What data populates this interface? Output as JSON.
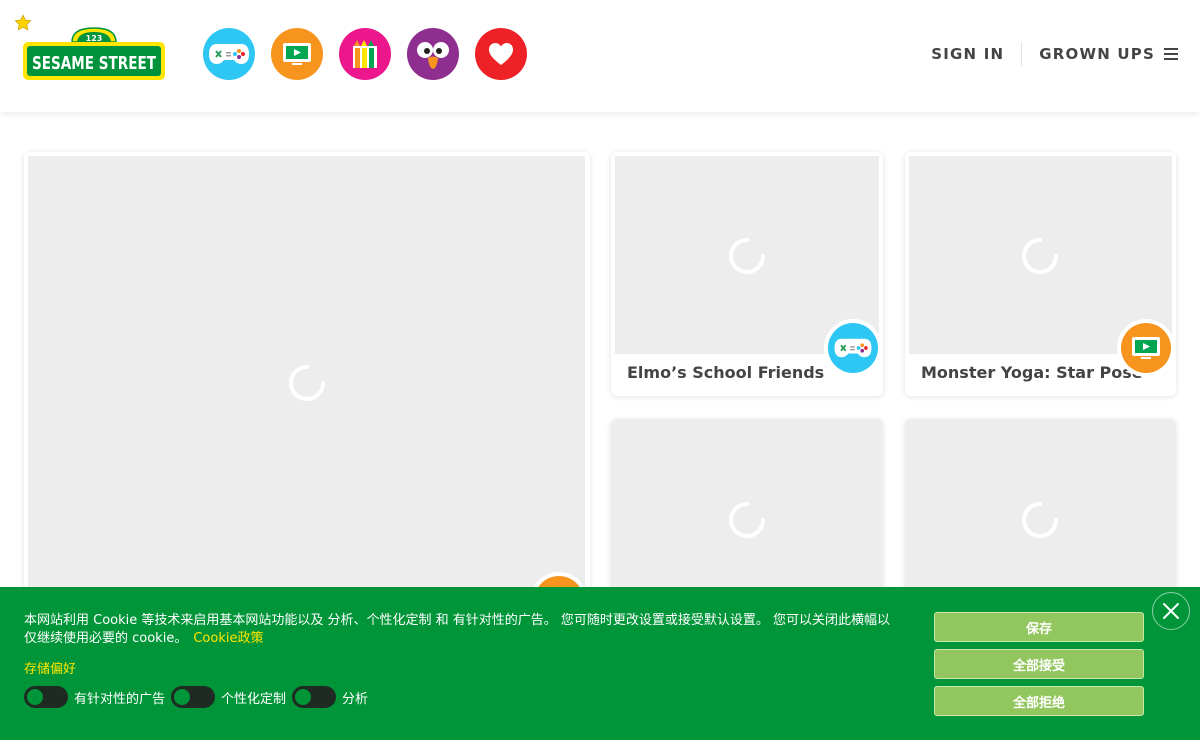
{
  "header": {
    "logo_text": "SESAME STREET",
    "logo_number": "123",
    "nav": [
      {
        "name": "games",
        "icon": "game-controller-icon",
        "color": "#2ec6f2"
      },
      {
        "name": "videos",
        "icon": "video-screen-icon",
        "color": "#f7941d"
      },
      {
        "name": "art",
        "icon": "crayons-icon",
        "color": "#ec178c"
      },
      {
        "name": "characters",
        "icon": "bird-face-icon",
        "color": "#8e2e8f"
      },
      {
        "name": "favorites",
        "icon": "heart-icon",
        "color": "#ee2126"
      }
    ],
    "sign_in": "SIGN IN",
    "grown_ups": "GROWN UPS"
  },
  "cards": [
    {
      "id": "featured",
      "title": "",
      "badge_icon": "video-screen-icon",
      "badge_color": "#f7941d"
    },
    {
      "id": "elmos-school-friends",
      "title": "Elmo’s School Friends",
      "badge_icon": "game-controller-icon",
      "badge_color": "#2ec6f2"
    },
    {
      "id": "monster-yoga",
      "title": "Monster Yoga: Star Pose",
      "badge_icon": "video-screen-icon",
      "badge_color": "#f7941d"
    },
    {
      "id": "card-4",
      "title": ""
    },
    {
      "id": "card-5",
      "title": ""
    }
  ],
  "cookie": {
    "text": "本网站利用 Cookie 等技术来启用基本网站功能以及 分析、个性化定制 和 有针对性的广告。 您可随时更改设置或接受默认设置。 您可以关闭此横幅以仅继续使用必要的 cookie。",
    "policy_link": "Cookie政策",
    "prefs_label": "存储偏好",
    "toggles": [
      {
        "label": "有针对性的广告",
        "on": false
      },
      {
        "label": "个性化定制",
        "on": false
      },
      {
        "label": "分析",
        "on": false
      }
    ],
    "buttons": {
      "save": "保存",
      "accept_all": "全部接受",
      "reject_all": "全部拒绝"
    },
    "colors": {
      "background": "#009539",
      "link": "#ffe500",
      "button": "#92c65f"
    }
  }
}
